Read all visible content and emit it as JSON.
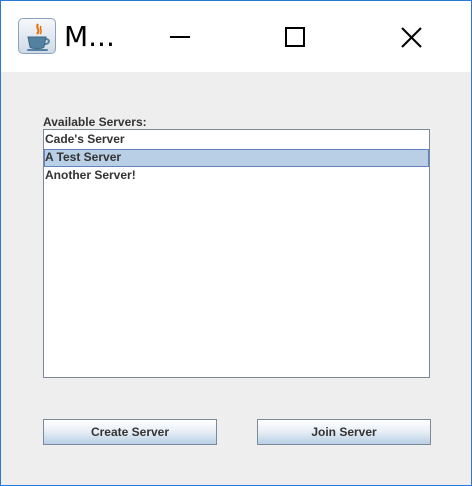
{
  "window": {
    "title": "M...",
    "accent_border": "#2b79d7"
  },
  "titlebar": {
    "app_icon": "java-cup-icon",
    "minimize_icon": "minimize-icon",
    "maximize_icon": "maximize-icon",
    "close_icon": "close-icon"
  },
  "servers": {
    "label": "Available Servers:",
    "items": [
      {
        "label": "Cade's Server",
        "selected": false
      },
      {
        "label": "A Test Server",
        "selected": true
      },
      {
        "label": "Another Server!",
        "selected": false
      }
    ],
    "selection_color": "#b8cfe5"
  },
  "buttons": {
    "create_label": "Create Server",
    "join_label": "Join Server"
  }
}
